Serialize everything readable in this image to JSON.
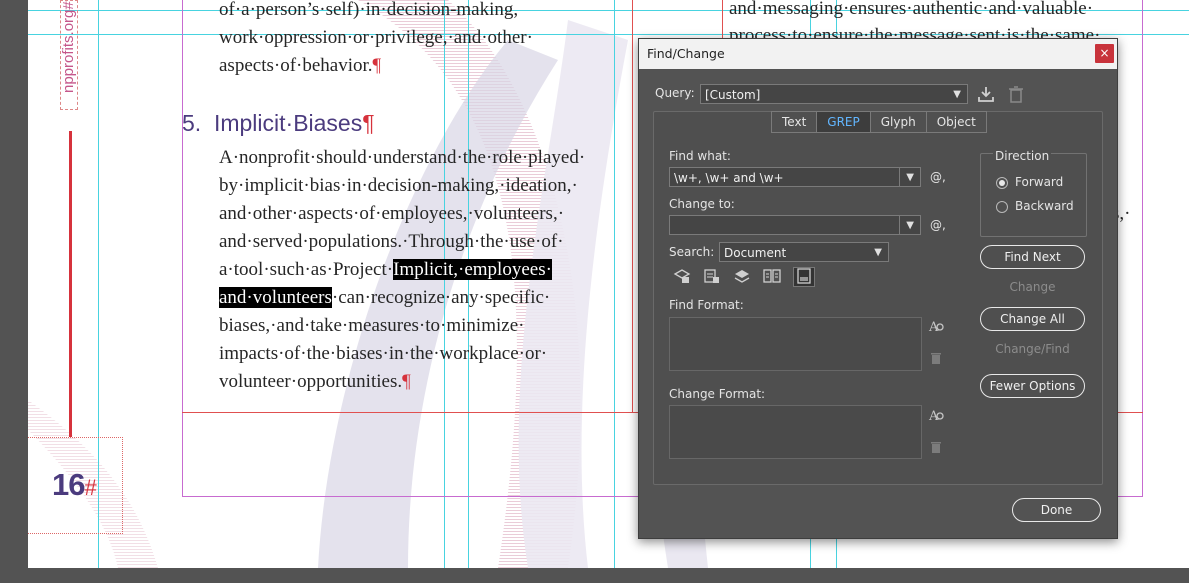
{
  "document": {
    "vertical_url": "npprofits.org#",
    "page_number": "16",
    "page_number_marker": "#",
    "body_prev_lines": [
      "of·a·person’s·self)·in·decision-making,",
      "work·oppression·or·privilege,·and·other·",
      "aspects·of·behavior."
    ],
    "heading_number": "5.",
    "heading_text": "Implicit·Biases",
    "pilcrow": "¶",
    "paragraph_lines": [
      "A·nonprofit·should·understand·the·role·played·",
      "by·implicit·bias·in·decision-making,·ideation,·",
      "and·other·aspects·of·employees,·volunteers,·",
      "and·served·populations.·Through·the·use·of·"
    ],
    "line5_plain": "a·tool·such·as·Project·",
    "line5_highlight": "Implicit,·employees·",
    "line6_highlight": "and·volunteers",
    "line6_plain": "·can·recognize·any·specific·",
    "paragraph_tail_lines": [
      "biases,·and·take·measures·to·minimize·",
      "impacts·of·the·biases·in·the·workplace·or·"
    ],
    "last_line": "volunteer·opportunities.",
    "right_col_line1": "and·messaging·ensures·authentic·and·valuable·",
    "right_col_line2": "process·to·ensure·the·message·sent·is·the·same·",
    "right_col_fragment": "s,·"
  },
  "dialog": {
    "title": "Find/Change",
    "close_glyph": "×",
    "query_label": "Query:",
    "query_value": "[Custom]",
    "tabs": [
      {
        "label": "Text",
        "active": false
      },
      {
        "label": "GREP",
        "active": true
      },
      {
        "label": "Glyph",
        "active": false
      },
      {
        "label": "Object",
        "active": false
      }
    ],
    "find_what_label": "Find what:",
    "find_what_value": "\\w+, \\w+ and \\w+",
    "change_to_label": "Change to:",
    "change_to_value": "",
    "special_char_glyph": "@,",
    "search_label": "Search:",
    "search_value": "Document",
    "find_format_label": "Find Format:",
    "change_format_label": "Change Format:",
    "direction_label": "Direction",
    "direction_options": [
      {
        "label": "Forward",
        "selected": true
      },
      {
        "label": "Backward",
        "selected": false
      }
    ],
    "buttons": {
      "find_next": "Find Next",
      "change": "Change",
      "change_all": "Change All",
      "change_find": "Change/Find",
      "fewer_options": "Fewer Options",
      "done": "Done"
    }
  },
  "colors": {
    "accent_tab": "#62b6ff",
    "heading": "#4b3b7e",
    "pilcrow": "#d6323c"
  }
}
